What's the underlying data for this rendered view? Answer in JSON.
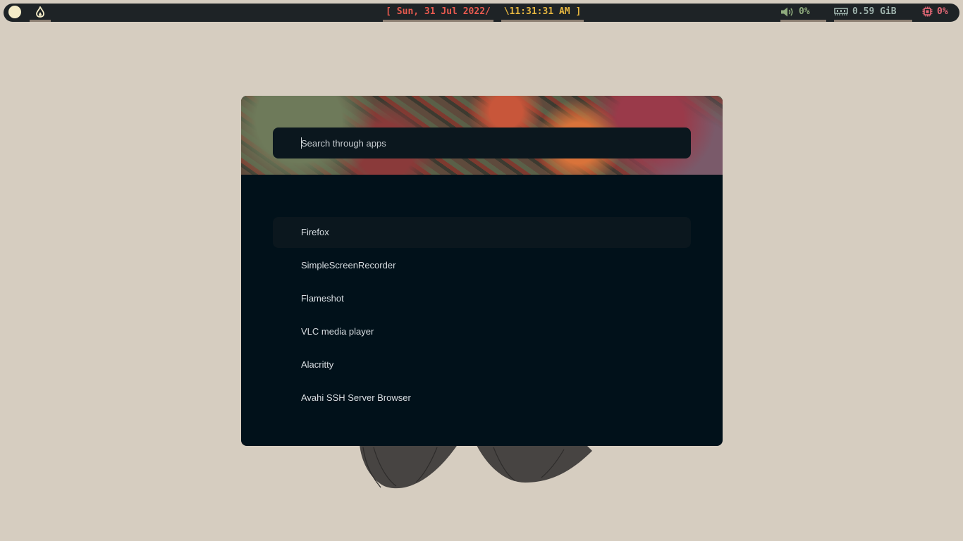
{
  "topbar": {
    "date": "[ Sun, 31 Jul 2022/",
    "time": "\\11:31:31 AM ]",
    "volume": "0%",
    "memory": "0.59 GiB",
    "cpu": "0%",
    "icons": {
      "left": "moon-icon",
      "launcher": "flame-icon",
      "volume": "speaker-icon",
      "memory": "ram-icon",
      "cpu": "cpu-icon"
    },
    "colors": {
      "bar": "#1e2326",
      "date": "#e85a4f",
      "time": "#e6b640",
      "volume": "#8fab7d",
      "memory": "#9fb3ad",
      "cpu": "#e46876"
    }
  },
  "launcher": {
    "search_placeholder": "Search through apps",
    "apps": [
      {
        "label": "Firefox",
        "selected": true
      },
      {
        "label": "SimpleScreenRecorder",
        "selected": false
      },
      {
        "label": "Flameshot",
        "selected": false
      },
      {
        "label": "VLC media player",
        "selected": false
      },
      {
        "label": "Alacritty",
        "selected": false
      },
      {
        "label": "Avahi SSH Server Browser",
        "selected": false
      }
    ]
  }
}
